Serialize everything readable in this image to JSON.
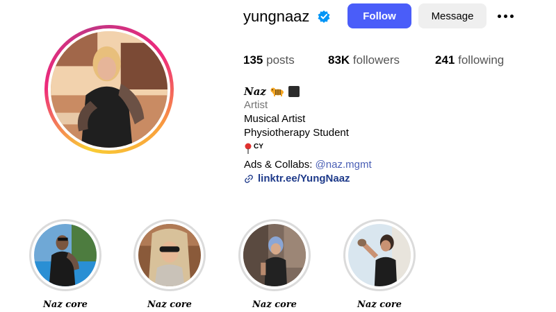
{
  "profile": {
    "username": "yungnaaz",
    "verified_icon": "verified-badge-icon",
    "follow_label": "Follow",
    "message_label": "Message",
    "more_icon": "more-options-icon"
  },
  "stats": {
    "posts_count": "135",
    "posts_label": "posts",
    "followers_count": "83K",
    "followers_label": "followers",
    "following_count": "241",
    "following_label": "following"
  },
  "bio": {
    "name": "Naz",
    "name_emojis": [
      "tiger-emoji",
      "black-square-emoji"
    ],
    "category": "Artist",
    "line1": "Musical Artist",
    "line2": "Physiotherapy Student",
    "location_icon": "round-pushpin-icon",
    "location": "CY",
    "ads_prefix": "Ads & Collabs: ",
    "ads_mention": "@naz.mgmt",
    "link_icon": "link-icon",
    "link": "linktr.ee/YungNaaz"
  },
  "highlights": [
    {
      "label": "Naz core"
    },
    {
      "label": "Naz core"
    },
    {
      "label": "Naz core"
    },
    {
      "label": "Naz core"
    }
  ],
  "colors": {
    "follow_button": "#4a5df9",
    "message_button": "#efefef",
    "mention": "#4a5fb5",
    "link": "#1e3a8a",
    "verified": "#0095f6"
  }
}
